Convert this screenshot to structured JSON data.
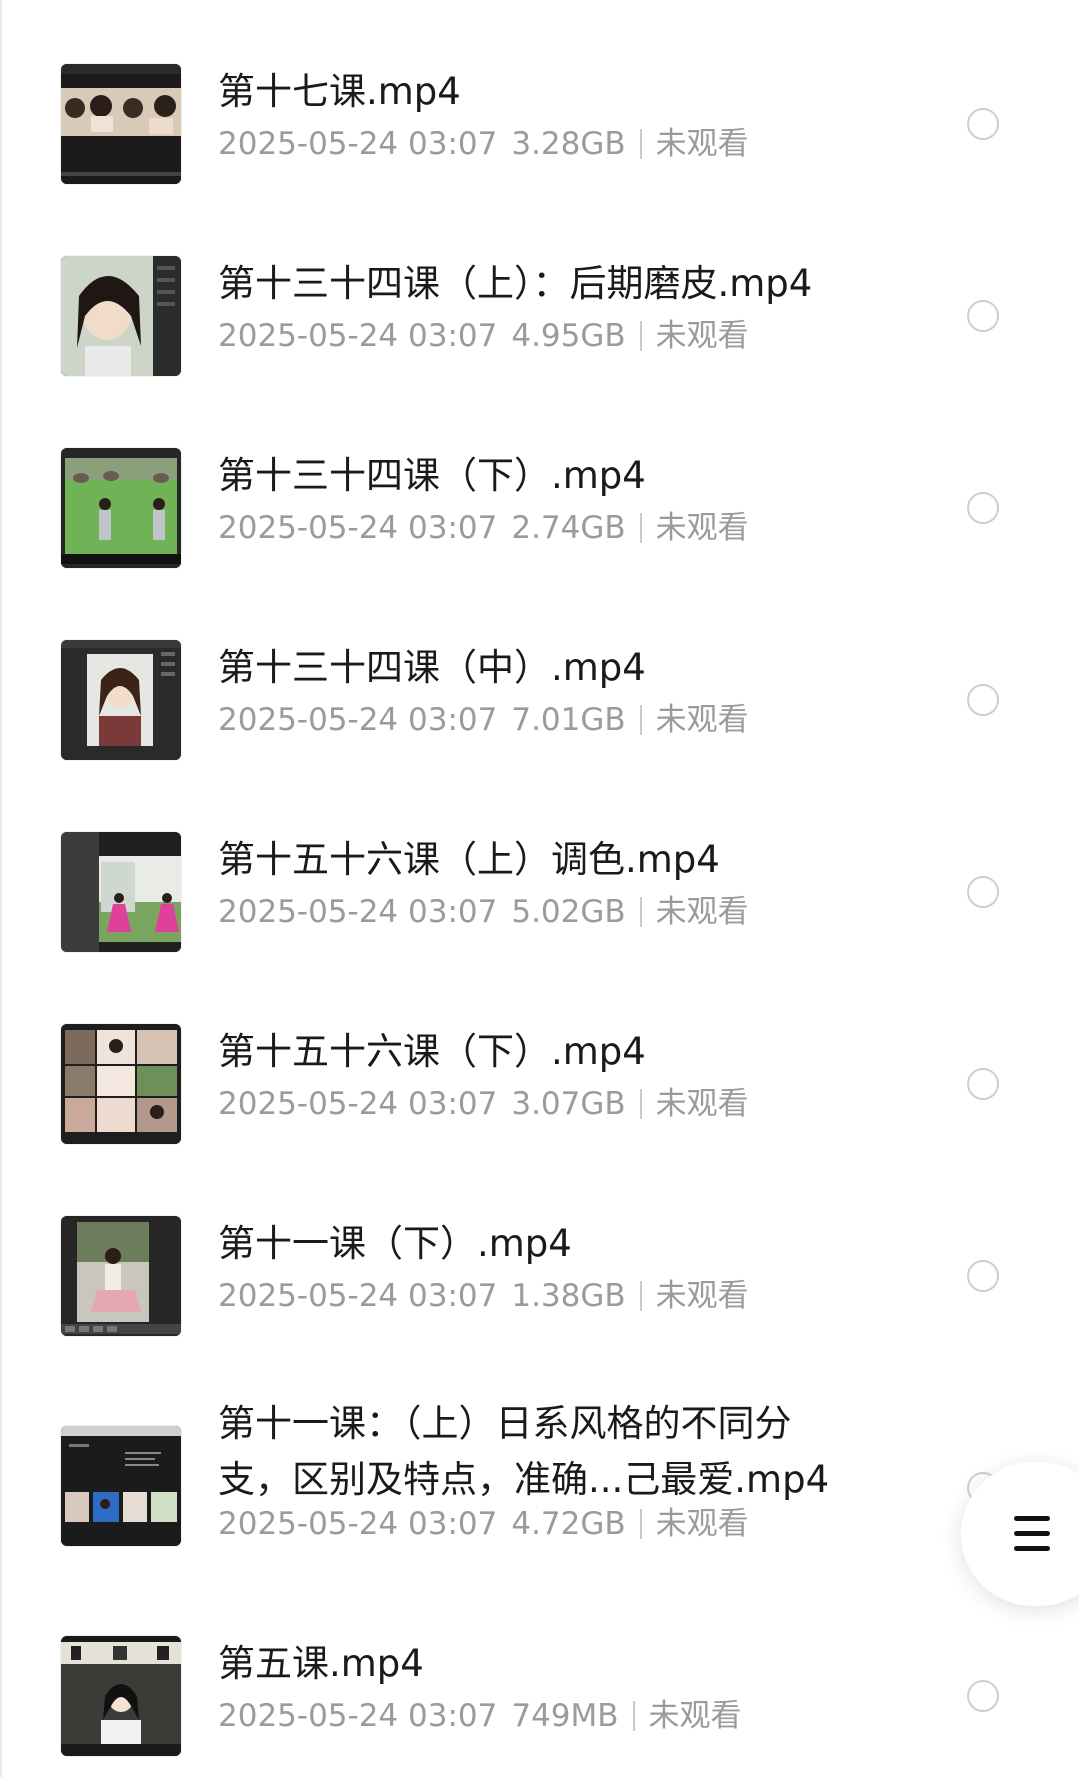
{
  "files": [
    {
      "title": "第十七课.mp4",
      "date": "2025-05-24 03:07",
      "size": "3.28GB",
      "status": "未观看",
      "thumb": "collage"
    },
    {
      "title": "第十三十四课（上）：后期磨皮.mp4",
      "date": "2025-05-24 03:07",
      "size": "4.95GB",
      "status": "未观看",
      "thumb": "portrait"
    },
    {
      "title": "第十三十四课（下）.mp4",
      "date": "2025-05-24 03:07",
      "size": "2.74GB",
      "status": "未观看",
      "thumb": "green-field"
    },
    {
      "title": "第十三十四课（中）.mp4",
      "date": "2025-05-24 03:07",
      "size": "7.01GB",
      "status": "未观看",
      "thumb": "editor-portrait"
    },
    {
      "title": "第十五十六课（上）调色.mp4",
      "date": "2025-05-24 03:07",
      "size": "5.02GB",
      "status": "未观看",
      "thumb": "pink-dress"
    },
    {
      "title": "第十五十六课（下）.mp4",
      "date": "2025-05-24 03:07",
      "size": "3.07GB",
      "status": "未观看",
      "thumb": "grid"
    },
    {
      "title": "第十一课（下）.mp4",
      "date": "2025-05-24 03:07",
      "size": "1.38GB",
      "status": "未观看",
      "thumb": "sitting"
    },
    {
      "title": "第十一课：（上）日系风格的不同分支，区别及特点，准确...己最爱.mp4",
      "title_line1": "第十一课：（上）日系风格的不同分",
      "title_line2": "支，区别及特点，准确...己最爱.mp4",
      "date": "2025-05-24 03:07",
      "size": "4.72GB",
      "status": "未观看",
      "thumb": "slides"
    },
    {
      "title": "第五课.mp4",
      "date": "2025-05-24 03:07",
      "size": "749MB",
      "status": "未观看",
      "thumb": "street"
    }
  ],
  "icons": {
    "select": "radio-circle-icon",
    "menu": "hamburger-menu-icon"
  },
  "colors": {
    "title": "#1a1a1a",
    "meta": "#9b9b9b",
    "radio_border": "#cfcfcf"
  }
}
